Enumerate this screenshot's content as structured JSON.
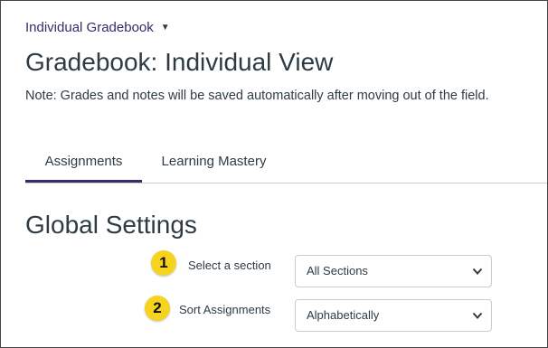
{
  "header": {
    "view_switcher_label": "Individual Gradebook",
    "title": "Gradebook: Individual View",
    "note": "Note: Grades and notes will be saved automatically after moving out of the field."
  },
  "tabs": [
    {
      "label": "Assignments",
      "active": true
    },
    {
      "label": "Learning Mastery",
      "active": false
    }
  ],
  "global_settings": {
    "title": "Global Settings",
    "section": {
      "badge": "1",
      "label": "Select a section",
      "selected": "All Sections"
    },
    "sort": {
      "badge": "2",
      "label": "Sort Assignments",
      "selected": "Alphabetically"
    }
  },
  "icons": {
    "view_switcher": "caret-down-icon",
    "select": "chevron-down-icon"
  },
  "colors": {
    "accent": "#3b2a6b",
    "text": "#2d3b45",
    "badge": "#f5d31f",
    "border": "#c7cdd1"
  }
}
